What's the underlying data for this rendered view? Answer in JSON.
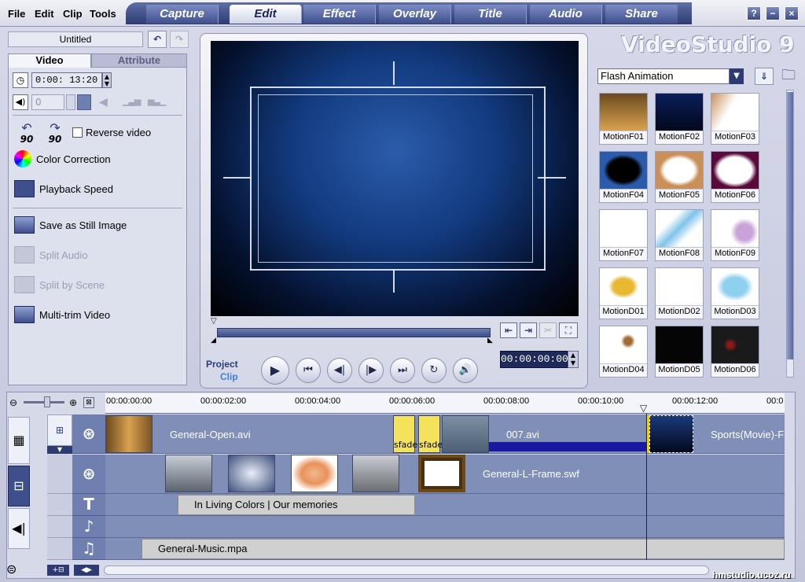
{
  "menu": [
    "File",
    "Edit",
    "Clip",
    "Tools"
  ],
  "tabs": [
    "Capture",
    "Edit",
    "Effect",
    "Overlay",
    "Title",
    "Audio",
    "Share"
  ],
  "active_tab": "Edit",
  "window_buttons": [
    "?",
    "−",
    "×"
  ],
  "project_name": "Untitled",
  "panel_tabs": [
    "Video",
    "Attribute"
  ],
  "duration": "0:00: 13:20",
  "volume": "0",
  "reverse_label": "Reverse video",
  "rotate_labels": [
    "90",
    "90"
  ],
  "actions": [
    {
      "label": "Color Correction",
      "enabled": true
    },
    {
      "label": "Playback Speed",
      "enabled": true
    },
    {
      "label": "Save as Still Image",
      "enabled": true
    },
    {
      "label": "Split Audio",
      "enabled": false
    },
    {
      "label": "Split by Scene",
      "enabled": false
    },
    {
      "label": "Multi-trim Video",
      "enabled": true
    }
  ],
  "app_logo": "VideoStudio 9",
  "library_category": "Flash Animation",
  "library_items": [
    "MotionF01",
    "MotionF02",
    "MotionF03",
    "MotionF04",
    "MotionF05",
    "MotionF06",
    "MotionF07",
    "MotionF08",
    "MotionF09",
    "MotionD01",
    "MotionD02",
    "MotionD03",
    "MotionD04",
    "MotionD05",
    "MotionD06"
  ],
  "playback": {
    "project_label": "Project",
    "clip_label": "Clip",
    "timecode": "00:00:00:00"
  },
  "ruler": [
    "00:00:00:00",
    "00:00:02:00",
    "00:00:04:00",
    "00:00:06:00",
    "00:00:08:00",
    "00:00:10:00",
    "00:00:12:00",
    "00:0"
  ],
  "timeline": {
    "video_clips": [
      "General-Open.avi",
      "007.avi",
      "Sports(Movie)-F"
    ],
    "transition_labels": [
      "sfade",
      "sfade"
    ],
    "overlay_clip": "General-L-Frame.swf",
    "title_clip": "In Living Colors | Our memories",
    "music_clip": "General-Music.mpa"
  },
  "watermark": "hmstudio.ucoz.ru",
  "colors": {
    "accent": "#3f4f8c",
    "track": "#7f8fb8",
    "screen": "#0a2a66"
  }
}
